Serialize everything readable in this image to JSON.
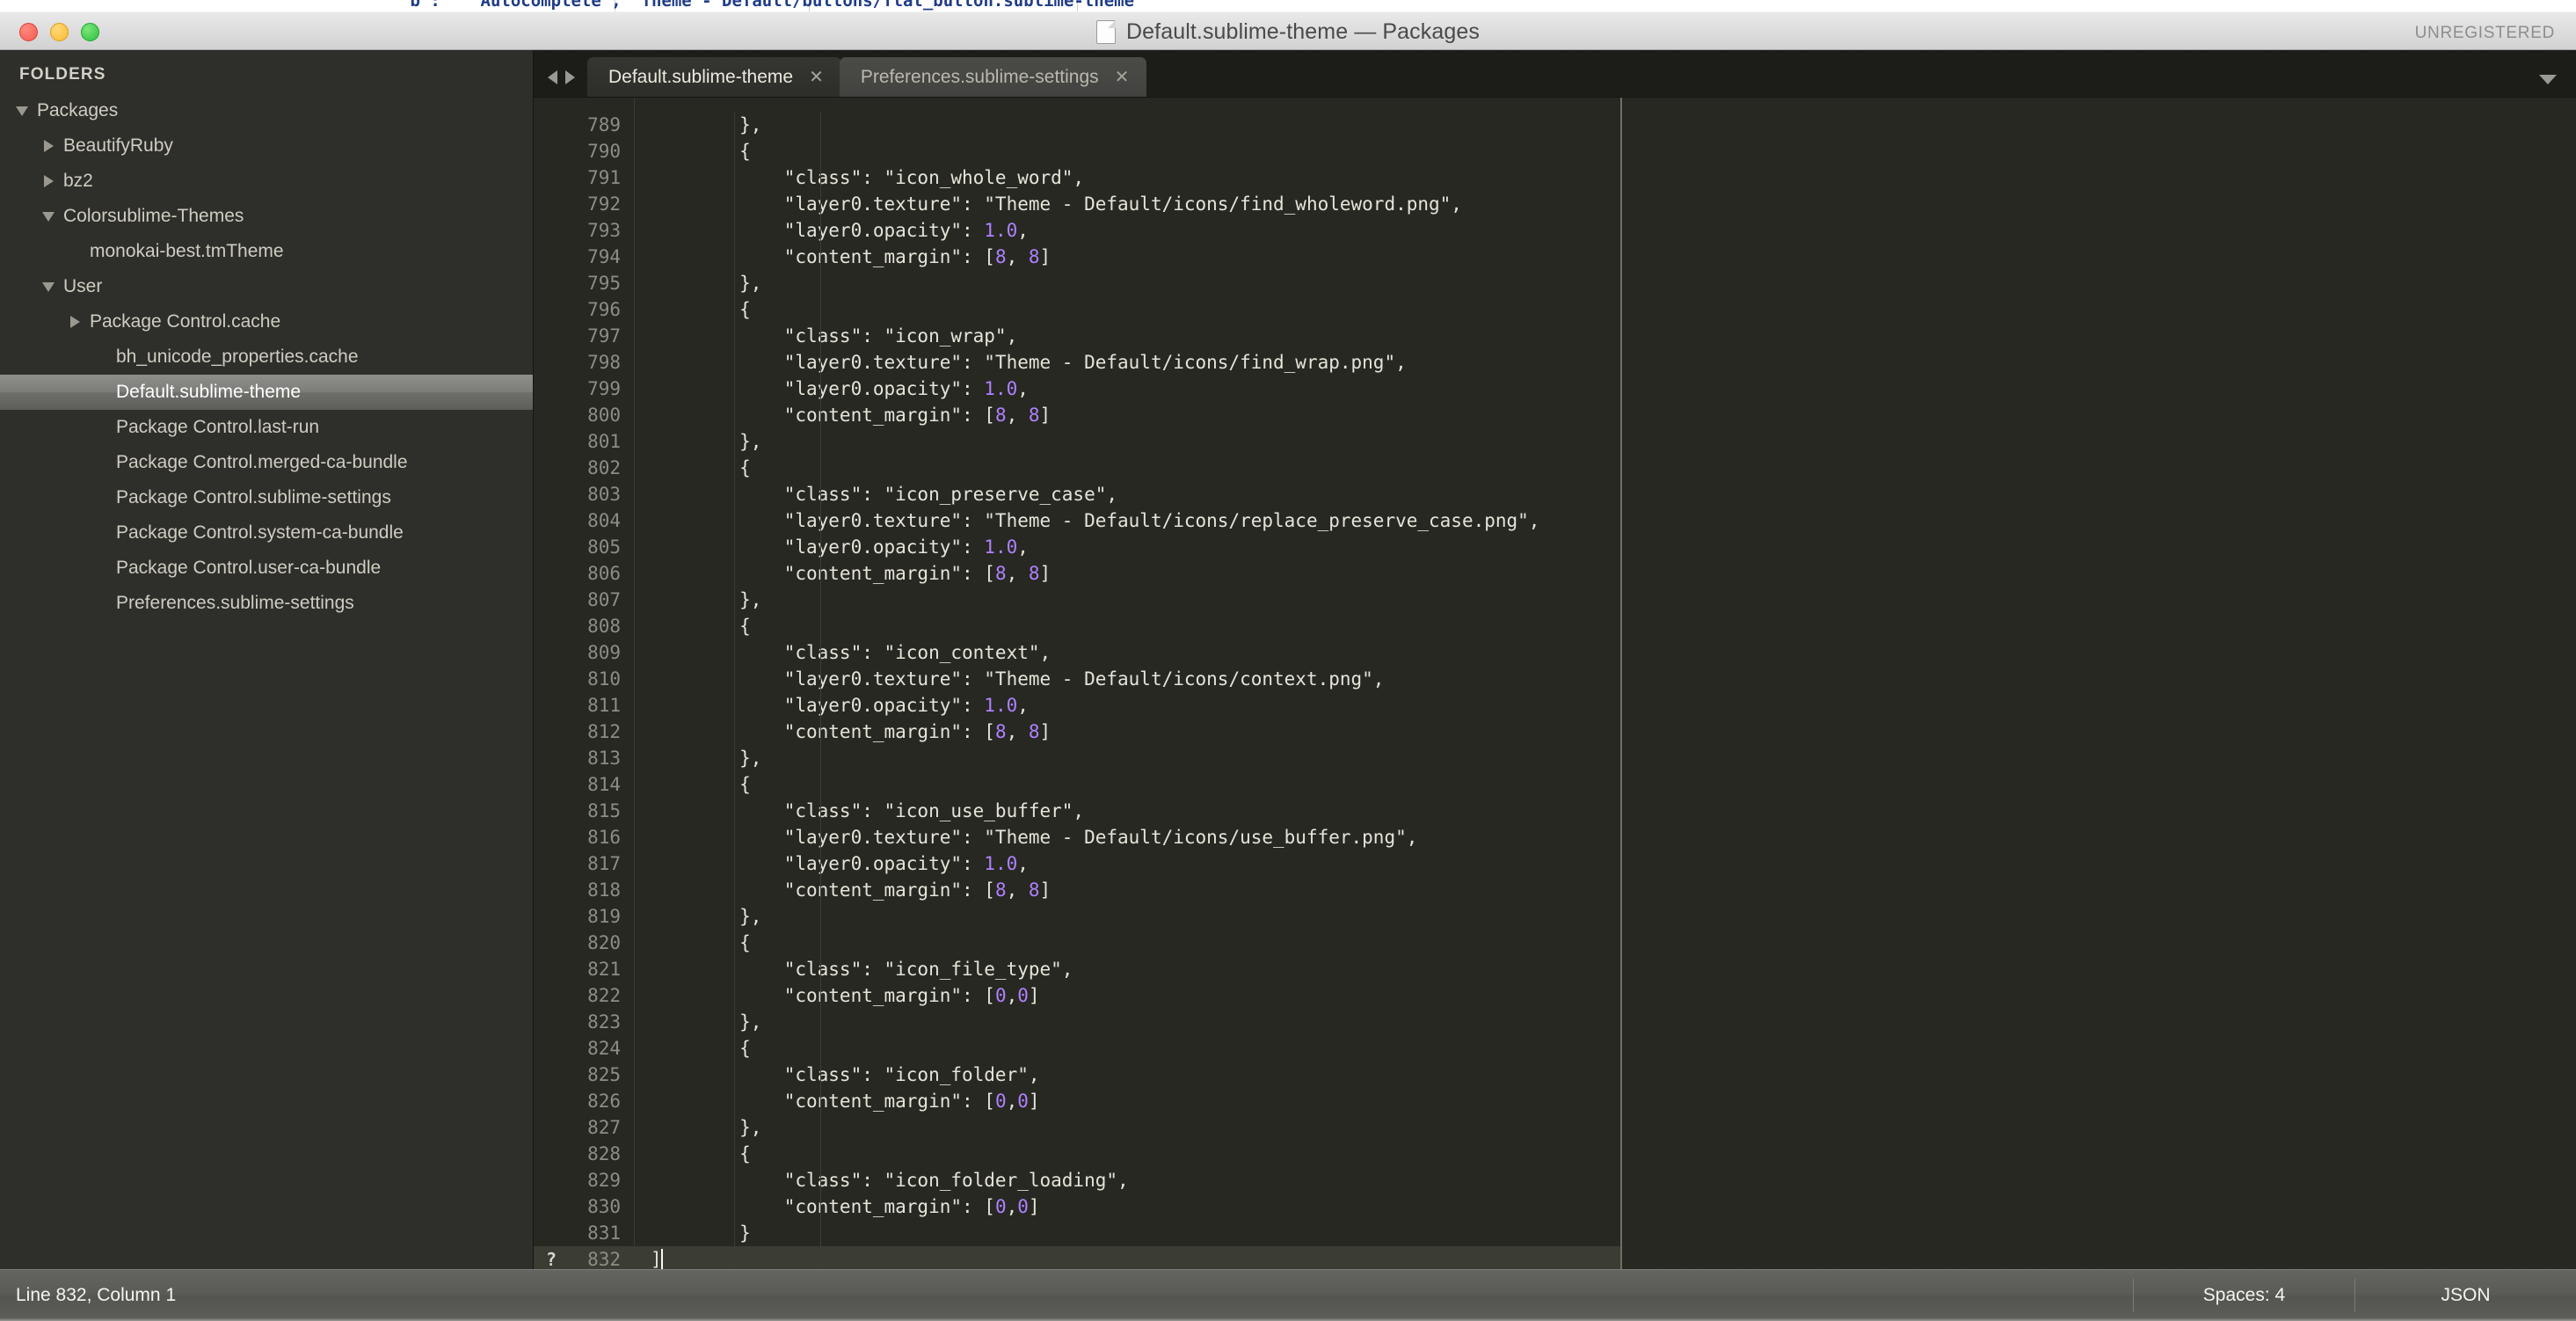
{
  "background_window": {
    "visible_text": "\"b\":   \"Autocomplete\", \"Theme - Default/buttons/flat_button.sublime-theme\""
  },
  "titlebar": {
    "title": "Default.sublime-theme — Packages",
    "license_badge": "UNREGISTERED",
    "traffic_lights": [
      "close-button",
      "minimize-button",
      "zoom-button"
    ]
  },
  "sidebar": {
    "header": "FOLDERS",
    "items": [
      {
        "label": "Packages",
        "indent": 0,
        "arrow": "down",
        "selected": false
      },
      {
        "label": "BeautifyRuby",
        "indent": 1,
        "arrow": "right",
        "selected": false
      },
      {
        "label": "bz2",
        "indent": 1,
        "arrow": "right",
        "selected": false
      },
      {
        "label": "Colorsublime-Themes",
        "indent": 1,
        "arrow": "down",
        "selected": false
      },
      {
        "label": "monokai-best.tmTheme",
        "indent": 2,
        "arrow": "none",
        "selected": false
      },
      {
        "label": "User",
        "indent": 1,
        "arrow": "down",
        "selected": false
      },
      {
        "label": "Package Control.cache",
        "indent": 2,
        "arrow": "right",
        "selected": false
      },
      {
        "label": "bh_unicode_properties.cache",
        "indent": 3,
        "arrow": "none",
        "selected": false
      },
      {
        "label": "Default.sublime-theme",
        "indent": 3,
        "arrow": "none",
        "selected": true
      },
      {
        "label": "Package Control.last-run",
        "indent": 3,
        "arrow": "none",
        "selected": false
      },
      {
        "label": "Package Control.merged-ca-bundle",
        "indent": 3,
        "arrow": "none",
        "selected": false
      },
      {
        "label": "Package Control.sublime-settings",
        "indent": 3,
        "arrow": "none",
        "selected": false
      },
      {
        "label": "Package Control.system-ca-bundle",
        "indent": 3,
        "arrow": "none",
        "selected": false
      },
      {
        "label": "Package Control.user-ca-bundle",
        "indent": 3,
        "arrow": "none",
        "selected": false
      },
      {
        "label": "Preferences.sublime-settings",
        "indent": 3,
        "arrow": "none",
        "selected": false
      }
    ]
  },
  "tabbar": {
    "nav_prev": "◀",
    "nav_next": "▶",
    "close_glyph": "✕",
    "tabs": [
      {
        "label": "Default.sublime-theme",
        "active": true
      },
      {
        "label": "Preferences.sublime-settings",
        "active": false
      }
    ]
  },
  "editor": {
    "first_line_number": 789,
    "cursor_line": 832,
    "cursor_column": 1,
    "bookmark_marker": "?",
    "lines": [
      {
        "n": 789,
        "segments": [
          {
            "t": "        },",
            "k": "plain"
          }
        ]
      },
      {
        "n": 790,
        "segments": [
          {
            "t": "        {",
            "k": "plain"
          }
        ]
      },
      {
        "n": 791,
        "segments": [
          {
            "t": "            \"class\": \"icon_whole_word\",",
            "k": "plain"
          }
        ]
      },
      {
        "n": 792,
        "segments": [
          {
            "t": "            \"layer0.texture\": \"Theme - Default/icons/find_wholeword.png\",",
            "k": "plain"
          }
        ]
      },
      {
        "n": 793,
        "segments": [
          {
            "t": "            \"layer0.opacity\": ",
            "k": "plain"
          },
          {
            "t": "1.0",
            "k": "num"
          },
          {
            "t": ",",
            "k": "plain"
          }
        ]
      },
      {
        "n": 794,
        "segments": [
          {
            "t": "            \"content_margin\": [",
            "k": "plain"
          },
          {
            "t": "8",
            "k": "num"
          },
          {
            "t": ", ",
            "k": "plain"
          },
          {
            "t": "8",
            "k": "num"
          },
          {
            "t": "]",
            "k": "plain"
          }
        ]
      },
      {
        "n": 795,
        "segments": [
          {
            "t": "        },",
            "k": "plain"
          }
        ]
      },
      {
        "n": 796,
        "segments": [
          {
            "t": "        {",
            "k": "plain"
          }
        ]
      },
      {
        "n": 797,
        "segments": [
          {
            "t": "            \"class\": \"icon_wrap\",",
            "k": "plain"
          }
        ]
      },
      {
        "n": 798,
        "segments": [
          {
            "t": "            \"layer0.texture\": \"Theme - Default/icons/find_wrap.png\",",
            "k": "plain"
          }
        ]
      },
      {
        "n": 799,
        "segments": [
          {
            "t": "            \"layer0.opacity\": ",
            "k": "plain"
          },
          {
            "t": "1.0",
            "k": "num"
          },
          {
            "t": ",",
            "k": "plain"
          }
        ]
      },
      {
        "n": 800,
        "segments": [
          {
            "t": "            \"content_margin\": [",
            "k": "plain"
          },
          {
            "t": "8",
            "k": "num"
          },
          {
            "t": ", ",
            "k": "plain"
          },
          {
            "t": "8",
            "k": "num"
          },
          {
            "t": "]",
            "k": "plain"
          }
        ]
      },
      {
        "n": 801,
        "segments": [
          {
            "t": "        },",
            "k": "plain"
          }
        ]
      },
      {
        "n": 802,
        "segments": [
          {
            "t": "        {",
            "k": "plain"
          }
        ]
      },
      {
        "n": 803,
        "segments": [
          {
            "t": "            \"class\": \"icon_preserve_case\",",
            "k": "plain"
          }
        ]
      },
      {
        "n": 804,
        "segments": [
          {
            "t": "            \"layer0.texture\": \"Theme - Default/icons/replace_preserve_case.png\",",
            "k": "plain"
          }
        ]
      },
      {
        "n": 805,
        "segments": [
          {
            "t": "            \"layer0.opacity\": ",
            "k": "plain"
          },
          {
            "t": "1.0",
            "k": "num"
          },
          {
            "t": ",",
            "k": "plain"
          }
        ]
      },
      {
        "n": 806,
        "segments": [
          {
            "t": "            \"content_margin\": [",
            "k": "plain"
          },
          {
            "t": "8",
            "k": "num"
          },
          {
            "t": ", ",
            "k": "plain"
          },
          {
            "t": "8",
            "k": "num"
          },
          {
            "t": "]",
            "k": "plain"
          }
        ]
      },
      {
        "n": 807,
        "segments": [
          {
            "t": "        },",
            "k": "plain"
          }
        ]
      },
      {
        "n": 808,
        "segments": [
          {
            "t": "        {",
            "k": "plain"
          }
        ]
      },
      {
        "n": 809,
        "segments": [
          {
            "t": "            \"class\": \"icon_context\",",
            "k": "plain"
          }
        ]
      },
      {
        "n": 810,
        "segments": [
          {
            "t": "            \"layer0.texture\": \"Theme - Default/icons/context.png\",",
            "k": "plain"
          }
        ]
      },
      {
        "n": 811,
        "segments": [
          {
            "t": "            \"layer0.opacity\": ",
            "k": "plain"
          },
          {
            "t": "1.0",
            "k": "num"
          },
          {
            "t": ",",
            "k": "plain"
          }
        ]
      },
      {
        "n": 812,
        "segments": [
          {
            "t": "            \"content_margin\": [",
            "k": "plain"
          },
          {
            "t": "8",
            "k": "num"
          },
          {
            "t": ", ",
            "k": "plain"
          },
          {
            "t": "8",
            "k": "num"
          },
          {
            "t": "]",
            "k": "plain"
          }
        ]
      },
      {
        "n": 813,
        "segments": [
          {
            "t": "        },",
            "k": "plain"
          }
        ]
      },
      {
        "n": 814,
        "segments": [
          {
            "t": "        {",
            "k": "plain"
          }
        ]
      },
      {
        "n": 815,
        "segments": [
          {
            "t": "            \"class\": \"icon_use_buffer\",",
            "k": "plain"
          }
        ]
      },
      {
        "n": 816,
        "segments": [
          {
            "t": "            \"layer0.texture\": \"Theme - Default/icons/use_buffer.png\",",
            "k": "plain"
          }
        ]
      },
      {
        "n": 817,
        "segments": [
          {
            "t": "            \"layer0.opacity\": ",
            "k": "plain"
          },
          {
            "t": "1.0",
            "k": "num"
          },
          {
            "t": ",",
            "k": "plain"
          }
        ]
      },
      {
        "n": 818,
        "segments": [
          {
            "t": "            \"content_margin\": [",
            "k": "plain"
          },
          {
            "t": "8",
            "k": "num"
          },
          {
            "t": ", ",
            "k": "plain"
          },
          {
            "t": "8",
            "k": "num"
          },
          {
            "t": "]",
            "k": "plain"
          }
        ]
      },
      {
        "n": 819,
        "segments": [
          {
            "t": "        },",
            "k": "plain"
          }
        ]
      },
      {
        "n": 820,
        "segments": [
          {
            "t": "        {",
            "k": "plain"
          }
        ]
      },
      {
        "n": 821,
        "segments": [
          {
            "t": "            \"class\": \"icon_file_type\",",
            "k": "plain"
          }
        ]
      },
      {
        "n": 822,
        "segments": [
          {
            "t": "            \"content_margin\": [",
            "k": "plain"
          },
          {
            "t": "0",
            "k": "num"
          },
          {
            "t": ",",
            "k": "plain"
          },
          {
            "t": "0",
            "k": "num"
          },
          {
            "t": "]",
            "k": "plain"
          }
        ]
      },
      {
        "n": 823,
        "segments": [
          {
            "t": "        },",
            "k": "plain"
          }
        ]
      },
      {
        "n": 824,
        "segments": [
          {
            "t": "        {",
            "k": "plain"
          }
        ]
      },
      {
        "n": 825,
        "segments": [
          {
            "t": "            \"class\": \"icon_folder\",",
            "k": "plain"
          }
        ]
      },
      {
        "n": 826,
        "segments": [
          {
            "t": "            \"content_margin\": [",
            "k": "plain"
          },
          {
            "t": "0",
            "k": "num"
          },
          {
            "t": ",",
            "k": "plain"
          },
          {
            "t": "0",
            "k": "num"
          },
          {
            "t": "]",
            "k": "plain"
          }
        ]
      },
      {
        "n": 827,
        "segments": [
          {
            "t": "        },",
            "k": "plain"
          }
        ]
      },
      {
        "n": 828,
        "segments": [
          {
            "t": "        {",
            "k": "plain"
          }
        ]
      },
      {
        "n": 829,
        "segments": [
          {
            "t": "            \"class\": \"icon_folder_loading\",",
            "k": "plain"
          }
        ]
      },
      {
        "n": 830,
        "segments": [
          {
            "t": "            \"content_margin\": [",
            "k": "plain"
          },
          {
            "t": "0",
            "k": "num"
          },
          {
            "t": ",",
            "k": "plain"
          },
          {
            "t": "0",
            "k": "num"
          },
          {
            "t": "]",
            "k": "plain"
          }
        ]
      },
      {
        "n": 831,
        "segments": [
          {
            "t": "        }",
            "k": "plain"
          }
        ]
      },
      {
        "n": 832,
        "segments": [
          {
            "t": "]",
            "k": "plain"
          }
        ],
        "current": true,
        "marker": "?",
        "cursor": true
      }
    ]
  },
  "statusbar": {
    "position": "Line 832, Column 1",
    "indentation": "Spaces: 4",
    "syntax": "JSON"
  },
  "colors": {
    "editor_background": "#272822",
    "sidebar_background": "#2e2e2a",
    "tabbar_background": "#1c1c18",
    "number_literal": "#ae81ff",
    "code_foreground": "#e6e4d8",
    "line_number": "#8d8d84",
    "current_line": "#3b3c32",
    "statusbar_background": "#5a5a57"
  }
}
